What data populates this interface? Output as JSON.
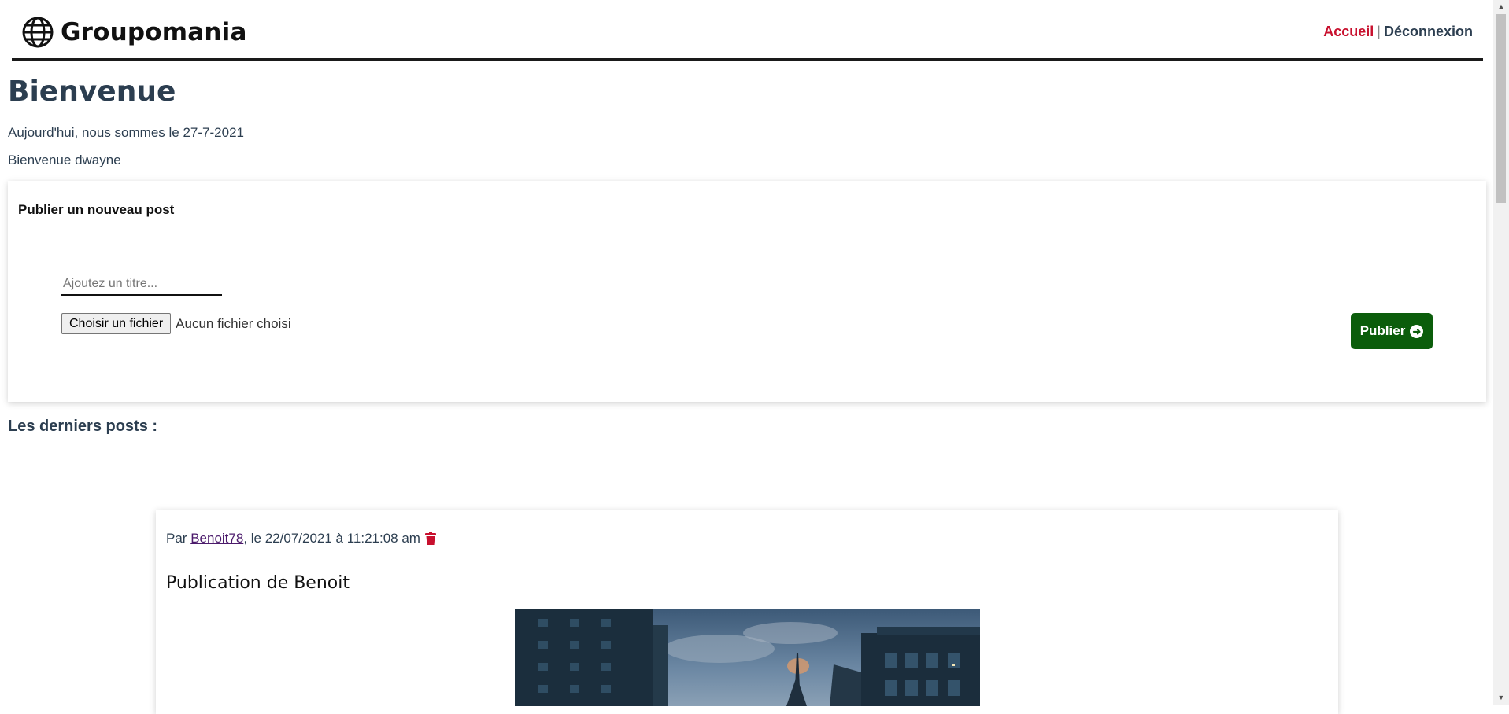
{
  "header": {
    "brand": "Groupomania",
    "logo_icon": "globe-icon",
    "nav": {
      "home": "Accueil",
      "separator": "|",
      "logout": "Déconnexion"
    },
    "colors": {
      "home_link": "#c8102e",
      "logout_link": "#2c3e50"
    }
  },
  "main": {
    "title": "Bienvenue",
    "date_line": "Aujourd'hui, nous sommes le 27-7-2021",
    "welcome_line": "Bienvenue dwayne"
  },
  "new_post": {
    "heading": "Publier un nouveau post",
    "title_placeholder": "Ajoutez un titre...",
    "title_value": "",
    "file_button": "Choisir un fichier",
    "file_status": "Aucun fichier choisi",
    "publish_label": "Publier",
    "publish_icon": "arrow-circle-right-icon",
    "publish_color": "#0b5d0b"
  },
  "latest": {
    "heading": "Les derniers posts :"
  },
  "posts": [
    {
      "prefix": "Par",
      "author": "Benoit78",
      "date_text": ", le 22/07/2021 à 11:21:08 am",
      "delete_icon": "trash-icon",
      "title": "Publication de Benoit",
      "image": "city-buildings-photo"
    }
  ]
}
